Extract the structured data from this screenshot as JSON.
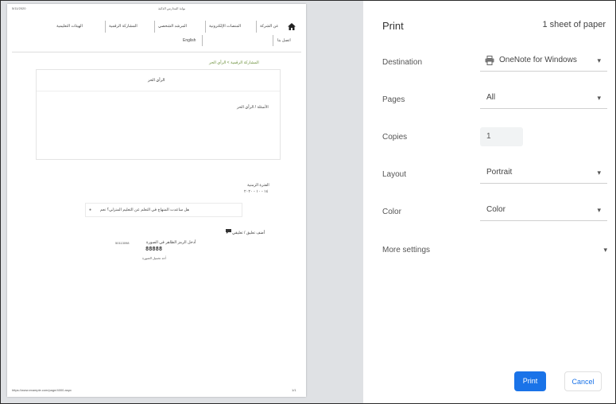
{
  "settings": {
    "title": "Print",
    "sheet_count": "1 sheet of paper",
    "destination": {
      "label": "Destination",
      "value": "OneNote for Windows"
    },
    "pages": {
      "label": "Pages",
      "value": "All"
    },
    "copies": {
      "label": "Copies",
      "value": "1"
    },
    "layout": {
      "label": "Layout",
      "value": "Portrait"
    },
    "color": {
      "label": "Color",
      "value": "Color"
    },
    "more_settings": "More settings",
    "print_button": "Print",
    "cancel_button": "Cancel",
    "chevron": "▾"
  },
  "preview": {
    "header_left": "5/11/2020",
    "header_center": "بوابة المدارس الذكية",
    "nav_items": [
      "عن الشركة",
      "المنصات الإلكترونية",
      "المرشد الشخصي",
      "المشاركة الرقمية",
      "الهيئات التعليمية"
    ],
    "nav_row2": [
      "اتصل بنا",
      "English"
    ],
    "section_label": "المشاركة الرقمية > الرأي الحر",
    "subject_value": "الرأي الحر",
    "comment_label": "الأسئلة / الرأي الحر",
    "date_label": "الفترة الزمنية",
    "date_value": "١٤ - ١٠ - ٢٠٢٠",
    "question_text": "هل ساعدت المنهاج في التعلم عن التعليم المنزلي؟ نعم",
    "comments_link": "أضف تعليق / تعليقي",
    "captcha_label": "أدخل الرمز الظاهر في الصورة",
    "captcha_code": "50113098",
    "captcha_dots": "88888",
    "captcha_hint": "أعد تحميل الصورة",
    "footer_url": "https://www.example.com/page/4000.aspx",
    "footer_page": "1/1"
  }
}
